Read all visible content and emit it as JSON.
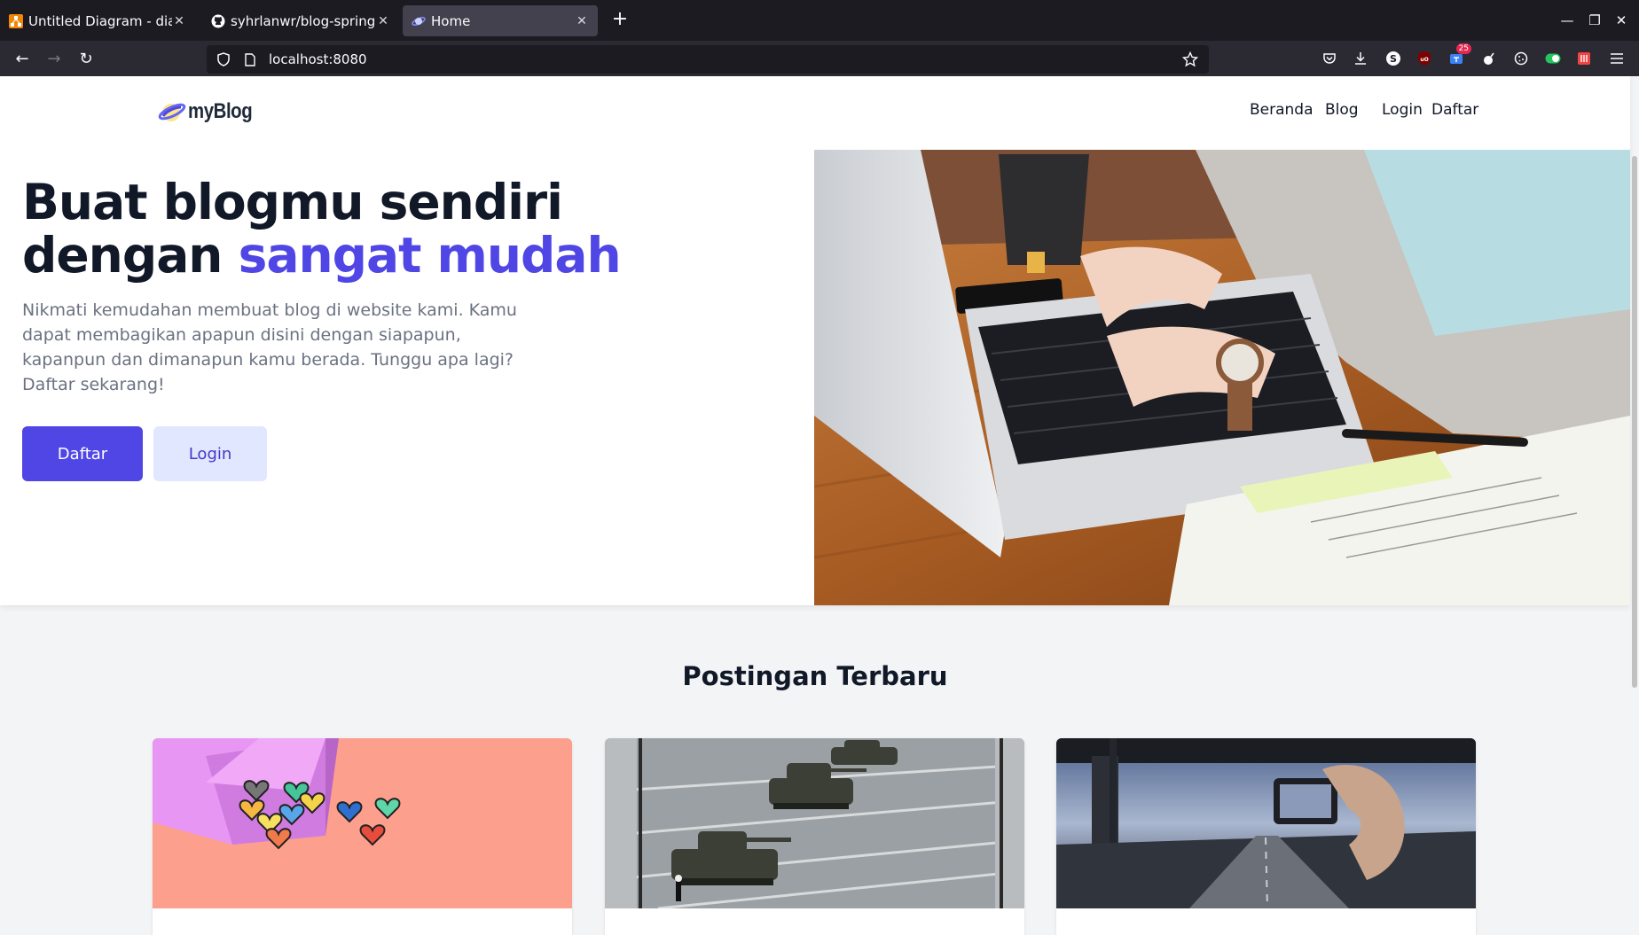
{
  "browser": {
    "tabs": [
      {
        "title": "Untitled Diagram - diagrams.net",
        "icon": "drawio-icon"
      },
      {
        "title": "syhrlanwr/blog-spring-boot",
        "icon": "github-icon"
      },
      {
        "title": "Home",
        "icon": "saturn-icon",
        "active": true
      }
    ],
    "url": "localhost:8080",
    "extension_badge": "25"
  },
  "page": {
    "logo_text": "myBlog",
    "nav": [
      "Beranda",
      "Blog",
      "Login",
      "Daftar"
    ],
    "hero": {
      "title_line1": "Buat blogmu sendiri",
      "title_line2_plain": "dengan ",
      "title_line2_accent": "sangat mudah",
      "lead": "Nikmati kemudahan membuat blog di website kami. Kamu dapat membagikan apapun disini dengan siapapun, kapanpun dan dimanapun kamu berada. Tunggu apa lagi? Daftar sekarang!",
      "primary_button": "Daftar",
      "secondary_button": "Login"
    },
    "section_title": "Postingan Terbaru"
  },
  "colors": {
    "accent": "#4f46e5",
    "accent_light": "#e0e7ff",
    "heading": "#111827",
    "muted": "#6b7280"
  }
}
